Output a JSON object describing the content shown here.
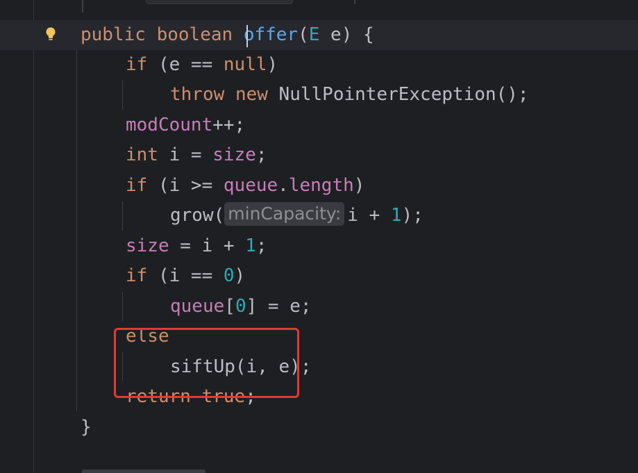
{
  "editor": {
    "hint_label": "minCapacity:",
    "lines": {
      "l1": {
        "kw1": "public",
        "kw2": "boolean",
        "fn": "offer",
        "paren_open": "(",
        "type": "E",
        "param": " e) {"
      },
      "l2": {
        "kw": "if",
        "rest1": " (e == ",
        "kw2": "null",
        "rest2": ")"
      },
      "l3": {
        "kw1": "throw",
        "kw2": "new",
        "rest": " NullPointerException();"
      },
      "l4": {
        "fld": "modCount",
        "rest": "++;"
      },
      "l5": {
        "kw": "int",
        "rest1": " i = ",
        "fld": "size",
        "rest2": ";"
      },
      "l6": {
        "kw": "if",
        "rest1": " (i >= ",
        "fld1": "queue",
        "dot": ".",
        "fld2": "length",
        "rest2": ")"
      },
      "l7": {
        "call": "grow(",
        "arg": "i + ",
        "num": "1",
        "rest": ");"
      },
      "l8": {
        "fld": "size",
        "rest1": " = i + ",
        "num": "1",
        "rest2": ";"
      },
      "l9": {
        "kw": "if",
        "rest1": " (i == ",
        "num": "0",
        "rest2": ")"
      },
      "l10": {
        "fld": "queue",
        "rest1": "[",
        "num": "0",
        "rest2": "] = e;"
      },
      "l11": {
        "kw": "else"
      },
      "l12": {
        "rest": "siftUp(i, e);"
      },
      "l13": {
        "kw1": "return",
        "kw2": "true",
        "rest": ";"
      },
      "l14": {
        "rest": "}"
      }
    }
  },
  "colors": {
    "background": "#1e1f22",
    "keyword": "#cf8e6d",
    "method_declaration": "#56a8f5",
    "field": "#c77dbb",
    "number": "#2aacb8",
    "default_text": "#bcbec4",
    "highlight_box": "#e53935"
  },
  "icons": {
    "gutter": "lightbulb-icon"
  }
}
